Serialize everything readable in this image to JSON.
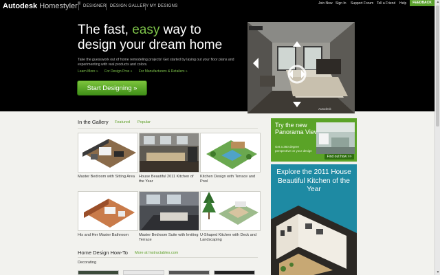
{
  "header": {
    "brand": "Autodesk",
    "product": "Homestyler",
    "product_mark": "®",
    "nav": [
      "DESIGNER",
      "DESIGN GALLERY",
      "MY DESIGNS"
    ],
    "utility_links": [
      "Join Now",
      "Sign In",
      "Support Forum",
      "Tell a Friend",
      "Help"
    ],
    "feedback": "FEEDBACK"
  },
  "hero": {
    "headline_1": "The fast, ",
    "headline_easy": "easy",
    "headline_2": " way to",
    "headline_3": "design your dream home",
    "lead": "Take the guesswork out of home remodeling projects! Get started by laying out your floor plans and experimenting with real products and colors.",
    "links": [
      "Learn More »",
      "For Design Pros »",
      "For Manufacturers & Retailers »"
    ],
    "cta": "Start Designing »",
    "image_credit": "Autodesk",
    "slides": 8,
    "active_slide": 1
  },
  "gallery": {
    "title": "In the Gallery",
    "tabs": [
      "Featured",
      "Popular"
    ],
    "items": [
      "Master Bedroom with Sitting Area",
      "House Beautiful 2011 Kitchen of the Year",
      "Kitchen Design with Terrace and Pool",
      "His and Her Master Bathroom",
      "Master Bedroom Suite with Inviting Terrace",
      "U-Shaped Kitchen with Deck and Landscaping"
    ]
  },
  "howto": {
    "title": "Home Design How-To",
    "link": "More at Instructables.com",
    "subsection": "Decorating"
  },
  "promos": {
    "panorama_title": "Try the new Panorama View",
    "panorama_sub": "Get a 360 degree perspective on your design",
    "panorama_btn": "Find out how >>",
    "kitchen_title": "Explore the 2011 House Beautiful Kitchen of the Year"
  },
  "colors": {
    "accent_green": "#7ec44a",
    "button_green": "#5aa02c",
    "promo_teal": "#1e8aa3"
  }
}
